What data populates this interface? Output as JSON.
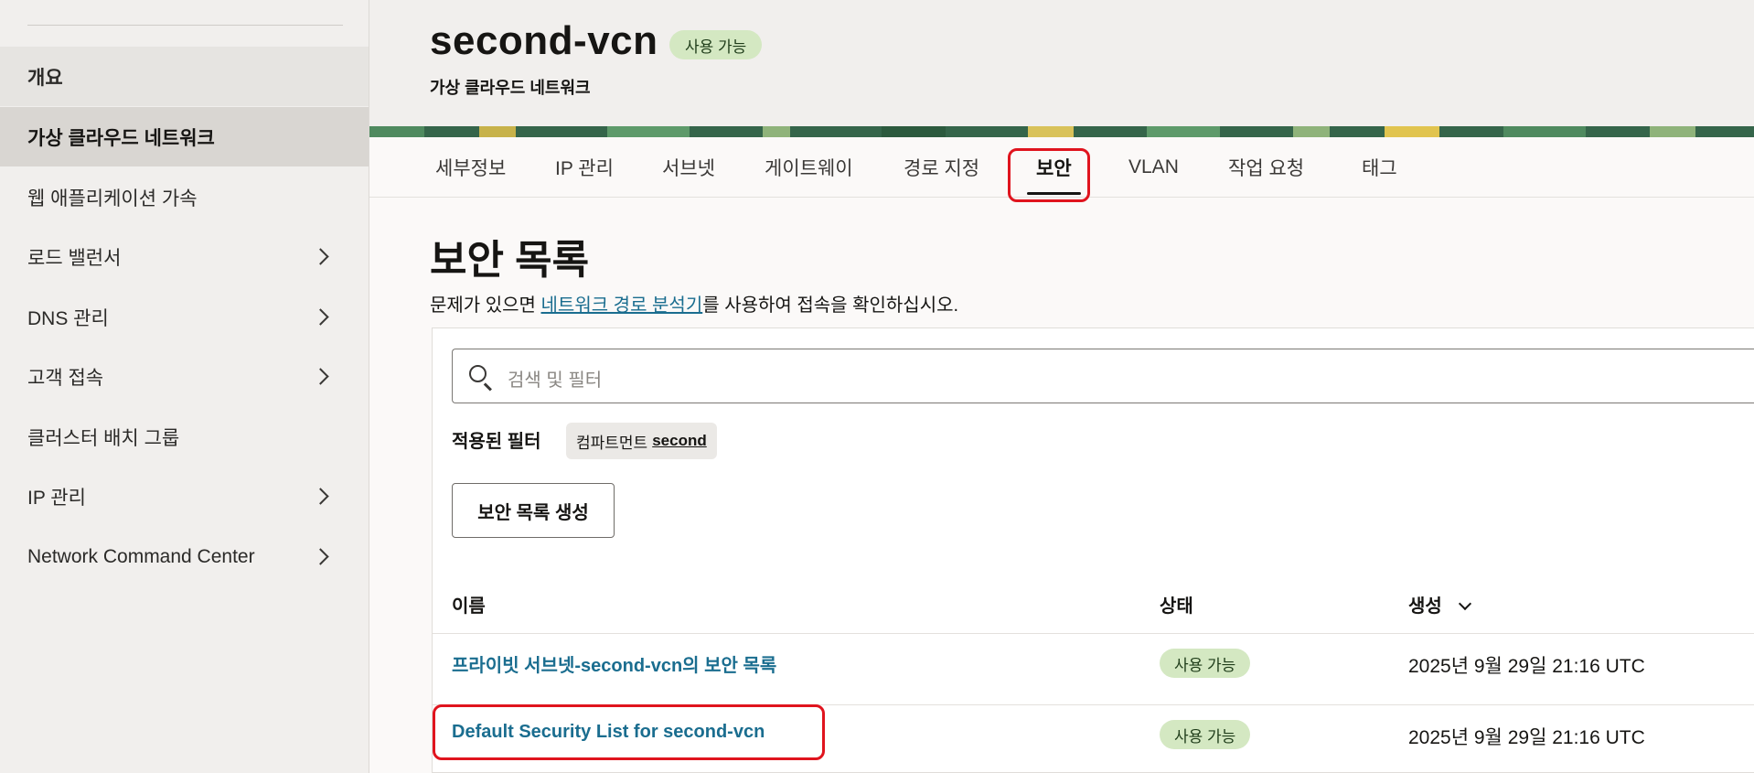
{
  "sidebar": {
    "items": [
      {
        "label": "개요"
      },
      {
        "label": "가상 클라우드 네트워크"
      },
      {
        "label": "웹 애플리케이션 가속"
      },
      {
        "label": "로드 밸런서"
      },
      {
        "label": "DNS 관리"
      },
      {
        "label": "고객 접속"
      },
      {
        "label": "클러스터 배치 그룹"
      },
      {
        "label": "IP 관리"
      },
      {
        "label": "Network Command Center"
      }
    ]
  },
  "header": {
    "title": "second-vcn",
    "status_badge": "사용 가능",
    "subtitle": "가상 클라우드 네트워크"
  },
  "tabs": [
    {
      "label": "세부정보"
    },
    {
      "label": "IP 관리"
    },
    {
      "label": "서브넷"
    },
    {
      "label": "게이트웨이"
    },
    {
      "label": "경로 지정"
    },
    {
      "label": "보안"
    },
    {
      "label": "VLAN"
    },
    {
      "label": "작업 요청"
    },
    {
      "label": "태그"
    }
  ],
  "main": {
    "page_title": "보안 목록",
    "help_prefix": "문제가 있으면 ",
    "help_link": "네트워크 경로 분석기",
    "help_suffix": "를 사용하여 접속을 확인하십시오.",
    "search_placeholder": "검색 및 필터",
    "applied_filters_label": "적용된 필터",
    "filter_chip_key": "컴파트먼트",
    "filter_chip_value": "second",
    "create_button": "보안 목록 생성"
  },
  "table": {
    "columns": [
      "이름",
      "상태",
      "생성"
    ],
    "rows": [
      {
        "name": "프라이빗 서브넷-second-vcn의 보안 목록",
        "status": "사용 가능",
        "created": "2025년 9월 29일 21:16 UTC"
      },
      {
        "name": "Default Security List for second-vcn",
        "status": "사용 가능",
        "created": "2025년 9월 29일 21:16 UTC"
      }
    ]
  },
  "colors": {
    "accent_link": "#1a6d8f",
    "status_badge_bg": "#d4e8c2",
    "highlight_red": "#e0141e"
  }
}
